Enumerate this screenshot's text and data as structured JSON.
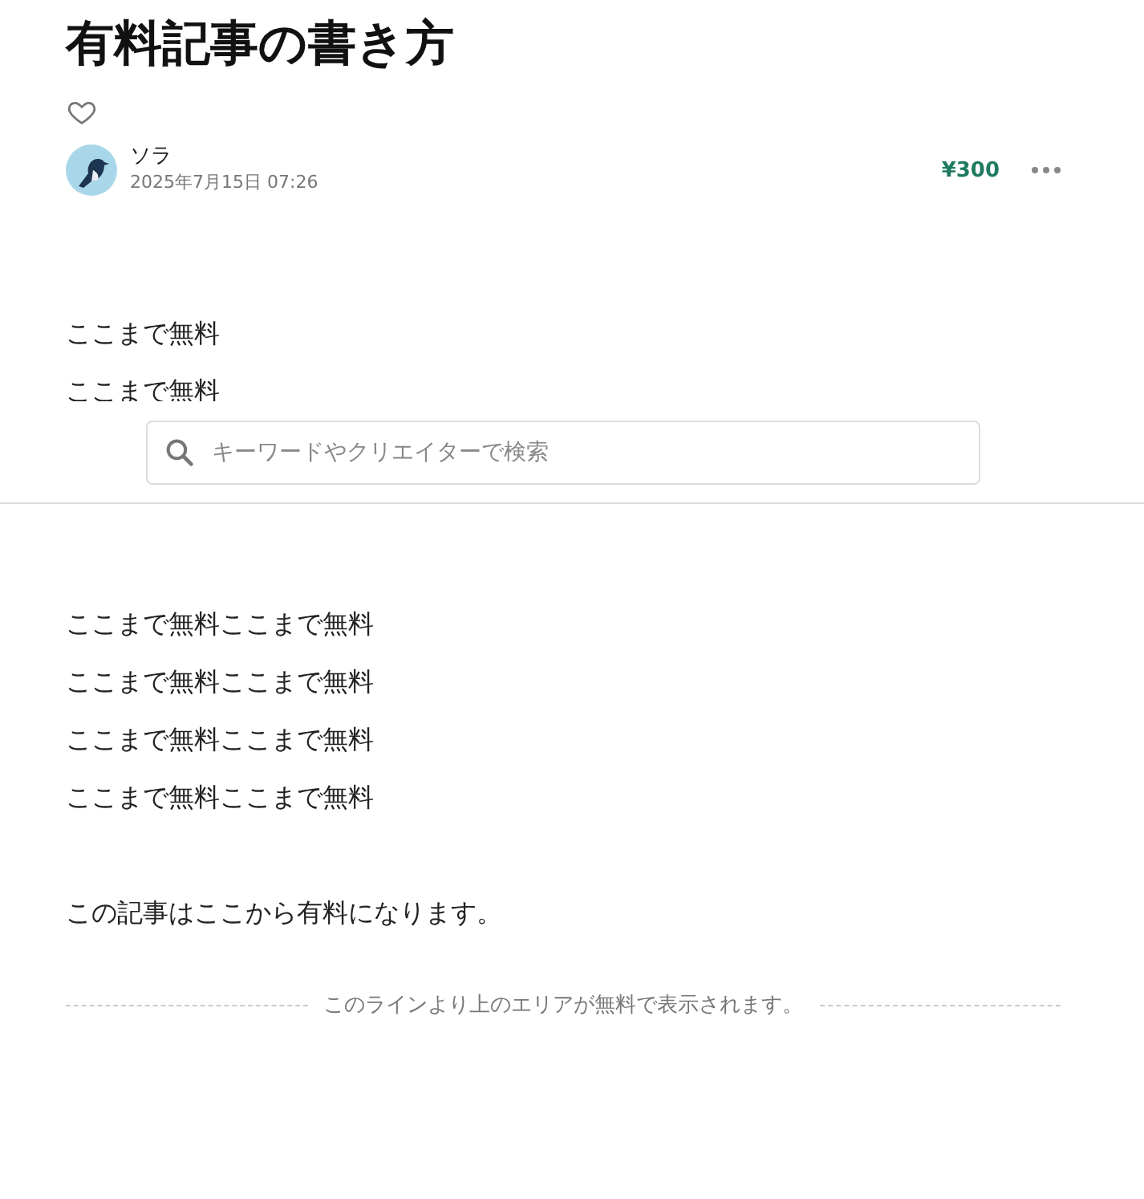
{
  "article": {
    "title": "有料記事の書き方",
    "liked": false,
    "author": {
      "name": "ソラ",
      "date": "2025年7月15日 07:26"
    },
    "price": "¥300"
  },
  "body": [
    {
      "lines": [
        "ここまで無料",
        "ここまで無料"
      ]
    },
    {
      "lines": [
        "ここまで無料ここまで無料",
        "ここまで無料ここまで無料",
        "ここまで無料ここまで無料",
        "ここまで無料ここまで無料"
      ]
    },
    {
      "lines": [
        "この記事はここから有料になります。"
      ]
    }
  ],
  "paywall_line": "このラインより上のエリアが無料で表示されます。",
  "search": {
    "placeholder": "キーワードやクリエイターで検索"
  }
}
